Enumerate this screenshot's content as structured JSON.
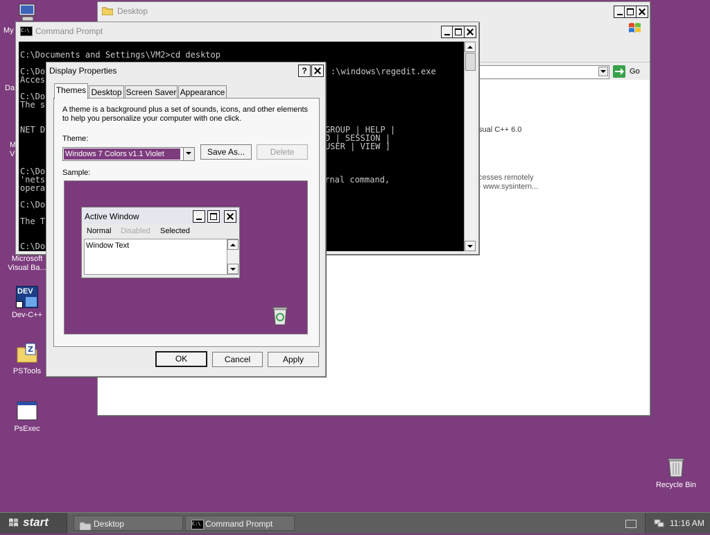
{
  "desktop": {
    "icons": {
      "my_computer": "My",
      "my_documents_partial": "Da",
      "my_network_partial_1": "M",
      "my_network_partial_2": "V",
      "vb_line1": "Microsoft",
      "vb_line2": "Visual Ba...",
      "devcpp": "Dev-C++",
      "devcpp_badge": "DEV",
      "pstools": "PSTools",
      "psexec": "PsExec",
      "recycle_bin": "Recycle Bin"
    }
  },
  "explorer": {
    "title": "Desktop",
    "go_label": "Go",
    "content_lines": [
      "sual C++ 6.0",
      "cesses remotely",
      "- www.sysintern..."
    ]
  },
  "cmd": {
    "title": "Command Prompt",
    "icon_text": "C:\\",
    "lines": [
      "C:\\Documents and Settings\\VM2>cd desktop",
      "C:\\Do",
      "Acces",
      "C:\\Do",
      "The s",
      "NET D",
      "C:\\Do",
      "'nets",
      "opera",
      "C:\\Do",
      "The T",
      "C:\\Do"
    ],
    "right_lines": [
      ":\\windows\\regedit.exe",
      "GROUP | HELP |",
      "D | SESSION |",
      "USER | VIEW ]",
      "ernal command,"
    ]
  },
  "dialog": {
    "title": "Display Properties",
    "help_label": "?",
    "tabs": [
      "Themes",
      "Desktop",
      "Screen Saver",
      "Appearance"
    ],
    "description_line1": "A theme is a background plus a set of sounds, icons, and other elements",
    "description_line2": "to help you personalize your computer with one click.",
    "theme_label": "Theme:",
    "theme_value": "Windows 7 Colors v1.1 Violet",
    "save_as": "Save As...",
    "delete": "Delete",
    "sample_label": "Sample:",
    "preview": {
      "title": "Active Window",
      "menu": [
        "Normal",
        "Disabled",
        "Selected"
      ],
      "window_text": "Window Text"
    },
    "ok": "OK",
    "cancel": "Cancel",
    "apply": "Apply"
  },
  "taskbar": {
    "start": "start",
    "items": [
      "Desktop",
      "Command Prompt"
    ],
    "cmd_icon_text": "C:\\",
    "clock": "11:16 AM"
  },
  "colors": {
    "desktop": "#7d3c7e",
    "preview_bg": "#7b3b7c",
    "taskbar": "#5e5e5e"
  }
}
